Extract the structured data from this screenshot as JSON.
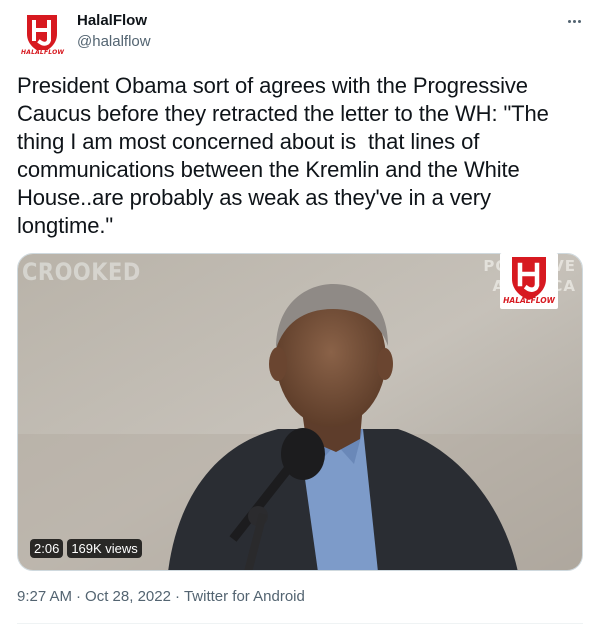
{
  "author": {
    "name": "HalalFlow",
    "handle": "@halalflow",
    "avatar_text": "HALALFLOW"
  },
  "tweet": {
    "text": "President Obama sort of agrees with the Progressive Caucus before they retracted the letter to the WH: \"The thing I am most concerned about is  that lines of communications between the Kremlin and the White House..are probably as weak as they've in a very longtime.\""
  },
  "media": {
    "watermark_left": "CROOKED",
    "watermark_right": "POD SAVE AMERICA",
    "duration": "2:06",
    "views": "169K views",
    "logo_text": "HALALFLOW"
  },
  "meta": {
    "time": "9:27 AM",
    "date": "Oct 28, 2022",
    "source": "Twitter for Android",
    "separator": "·"
  },
  "colors": {
    "brand_red": "#d71920",
    "text_primary": "#0f1419",
    "text_secondary": "#536471"
  },
  "icons": {
    "more": "more-dots-icon",
    "avatar": "halalflow-logo"
  }
}
